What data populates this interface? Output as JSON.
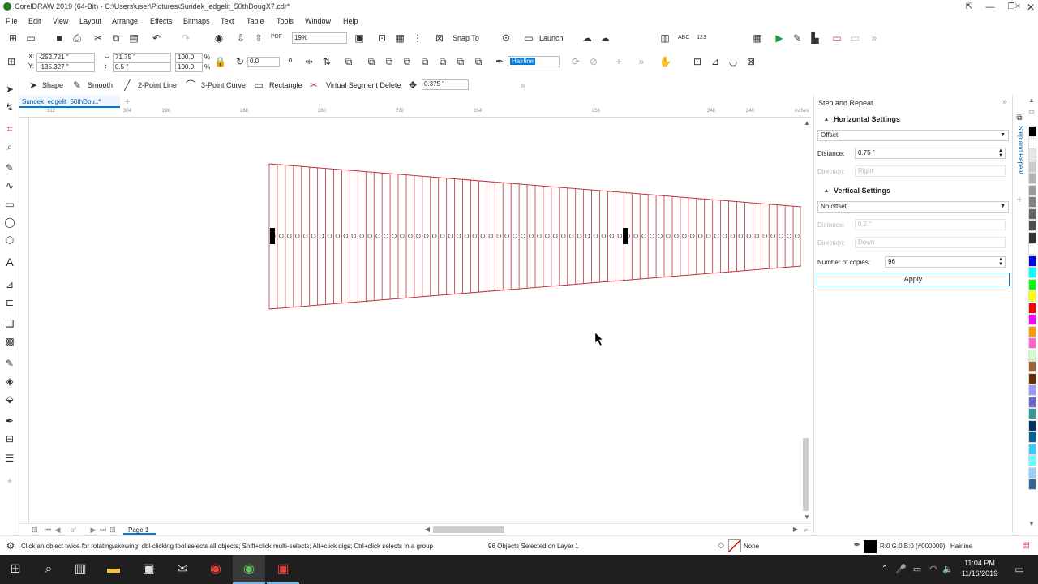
{
  "window": {
    "title": "CorelDRAW 2019 (64-Bit) - C:\\Users\\user\\Pictures\\Sundek_edgelit_50thDougX7.cdr*"
  },
  "menu": [
    "File",
    "Edit",
    "View",
    "Layout",
    "Arrange",
    "Effects",
    "Bitmaps",
    "Text",
    "Table",
    "Tools",
    "Window",
    "Help"
  ],
  "toolbar": {
    "zoom": "19%",
    "snap_to": "Snap To",
    "launch": "Launch"
  },
  "propbar": {
    "x": "-252.721 \"",
    "y": "-135.327 \"",
    "w": "71.75 \"",
    "h": "0.5 \"",
    "scale_w": "100.0",
    "scale_h": "100.0",
    "pct": "%",
    "rotation": "0.0",
    "outline": "Hairline"
  },
  "shapebar": {
    "shape": "Shape",
    "smooth": "Smooth",
    "two_point": "2-Point Line",
    "three_point": "3-Point Curve",
    "rectangle": "Rectangle",
    "vsd": "Virtual Segment Delete",
    "nudge": "0.375 \""
  },
  "doc_tab": "Sundek_edgelit_50thDou..*",
  "ruler": {
    "ticks": [
      "312",
      "304",
      "296",
      "288",
      "280",
      "272",
      "264",
      "256",
      "248",
      "240"
    ],
    "unit": "inches"
  },
  "pagenav": {
    "of": "of",
    "page": "Page 1"
  },
  "docker": {
    "title": "Step and Repeat",
    "h_section": "Horizontal Settings",
    "h_mode": "Offset",
    "distance_label": "Distance:",
    "h_distance": "0.75 \"",
    "direction_label": "Direction:",
    "h_direction": "Right",
    "v_section": "Vertical Settings",
    "v_mode": "No offset",
    "v_distance": "0.2 \"",
    "v_direction": "Down",
    "copies_label": "Number of copies:",
    "copies": "96",
    "apply": "Apply",
    "side_tab": "Step and Repeat"
  },
  "palette": [
    "#000000",
    "#ffffff",
    "#e6e6e6",
    "#cccccc",
    "#b3b3b3",
    "#999999",
    "#808080",
    "#666666",
    "#4d4d4d",
    "#333333",
    "#ffffff",
    "#0000ff",
    "#00ffff",
    "#00ff00",
    "#ffff00",
    "#ff0000",
    "#ff00ff",
    "#ff9900",
    "#ff66cc",
    "#ccffcc",
    "#996633",
    "#663300",
    "#9999ff",
    "#6666cc",
    "#339999",
    "#003366",
    "#006699",
    "#33ccff",
    "#66ffff",
    "#99ccff",
    "#336699"
  ],
  "status": {
    "hint": "Click an object twice for rotating/skewing; dbl-clicking tool selects all objects; Shift+click multi-selects; Alt+click digs; Ctrl+click selects in a group",
    "selected": "96 Objects Selected on Layer 1",
    "fill": "None",
    "color": "R:0 G:0 B:0 (#000000)",
    "outline": "Hairline"
  },
  "clock": {
    "time": "11:04 PM",
    "date": "11/16/2019"
  },
  "colors": {
    "stroke": "#c0303a",
    "accent": "#0078d7"
  }
}
